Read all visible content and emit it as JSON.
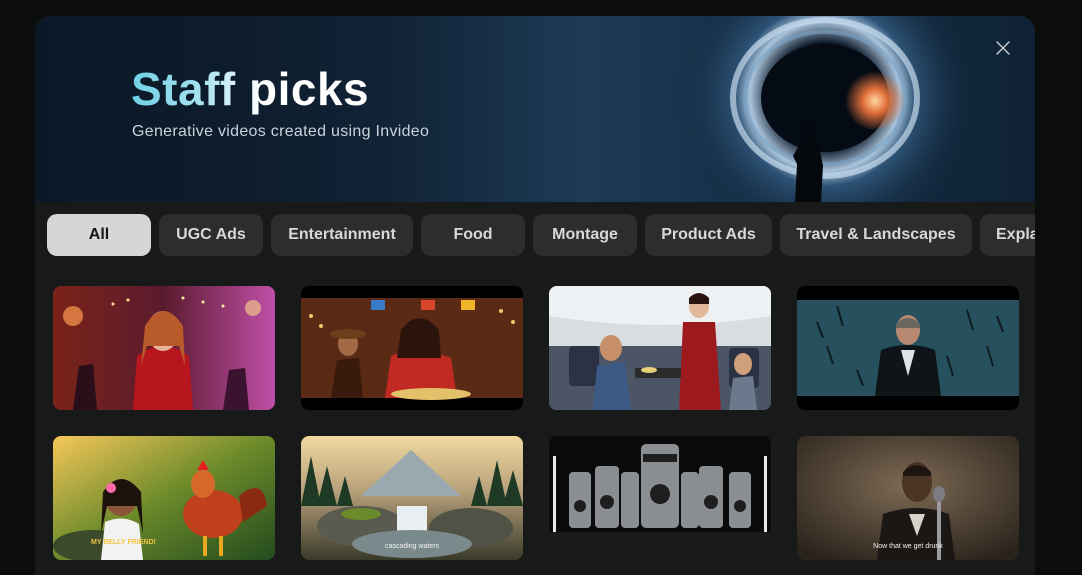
{
  "header": {
    "title": "Staff picks",
    "subtitle": "Generative videos created using Invideo"
  },
  "close_icon": "close-icon",
  "filters": [
    "All",
    "UGC Ads",
    "Entertainment",
    "Food",
    "Montage",
    "Product Ads",
    "Travel & Landscapes",
    "Expla"
  ],
  "active_filter": "All",
  "videos": {
    "row1": [
      "party-scene",
      "mexican-restaurant-scene",
      "airplane-cabin-scene",
      "suited-agent-scene"
    ],
    "row2": [
      "cartoon-girl-rooster",
      "mountain-waterfall",
      "death-cans-product",
      "singer-microphone"
    ]
  },
  "captions": {
    "girl": "MY BELLY FRIEND!",
    "waterfall": "cascading waters",
    "singer": "Now that we get drunk"
  },
  "colors": {
    "active_chip": "#d6d6d6",
    "chip": "#2c2d2d",
    "title_accent": "#6fd0e6"
  }
}
